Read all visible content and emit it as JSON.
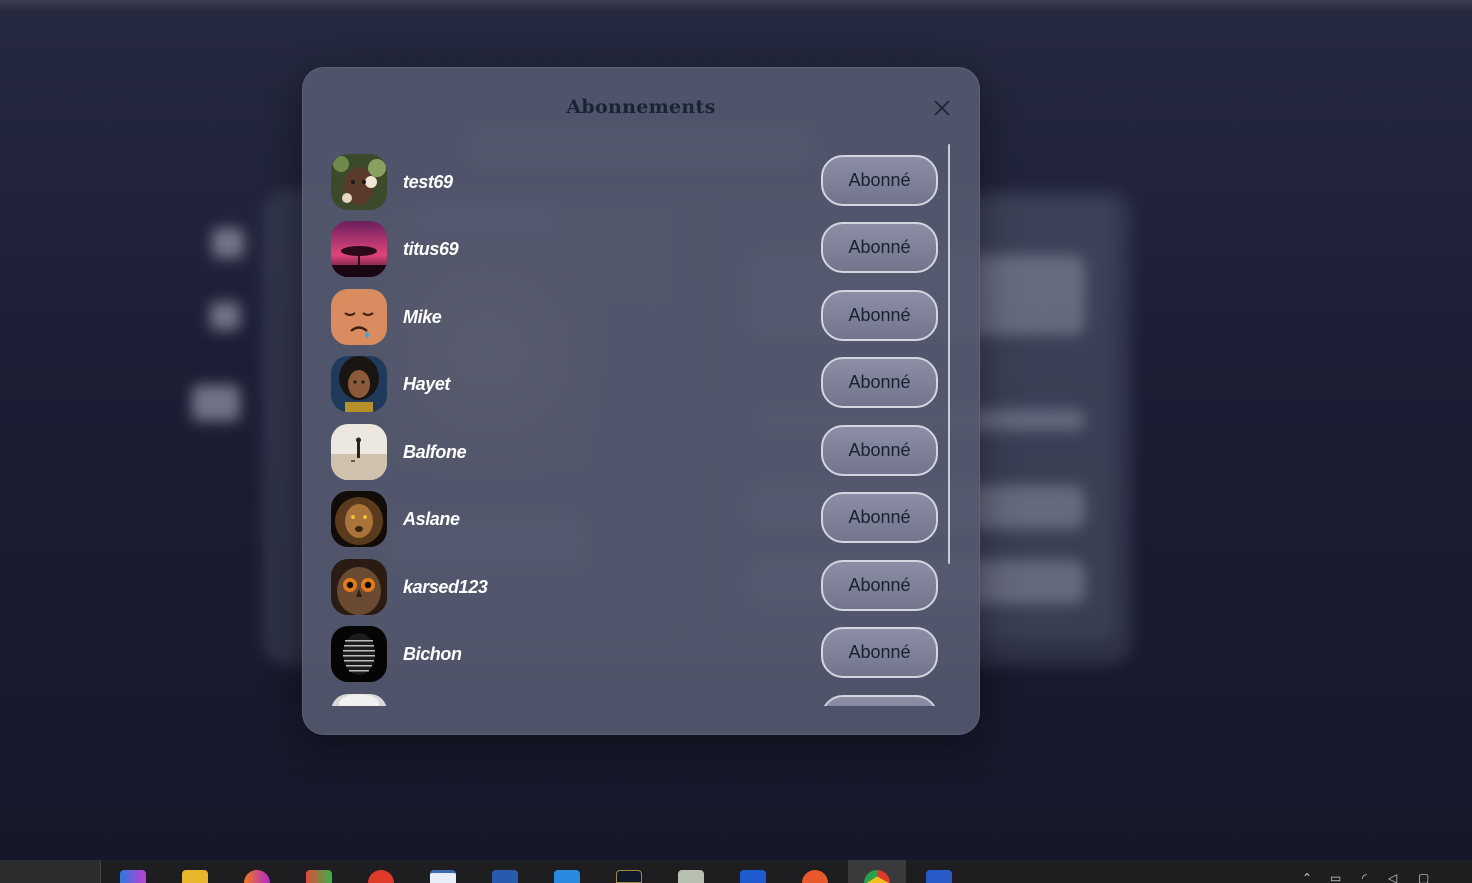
{
  "modal": {
    "title": "Abonnements",
    "close_icon": "close-icon",
    "followings": [
      {
        "username": "test69",
        "button_label": "Abonné",
        "avatar": "woman-with-flowers-avatar"
      },
      {
        "username": "titus69",
        "button_label": "Abonné",
        "avatar": "pink-tree-sunset-avatar"
      },
      {
        "username": "Mike",
        "button_label": "Abonné",
        "avatar": "sad-face-emoji-avatar"
      },
      {
        "username": "Hayet",
        "button_label": "Abonné",
        "avatar": "woman-portrait-avatar"
      },
      {
        "username": "Balfone",
        "button_label": "Abonné",
        "avatar": "beach-figure-avatar"
      },
      {
        "username": "Aslane",
        "button_label": "Abonné",
        "avatar": "lion-avatar"
      },
      {
        "username": "karsed123",
        "button_label": "Abonné",
        "avatar": "owl-avatar"
      },
      {
        "username": "Bichon",
        "button_label": "Abonné",
        "avatar": "striped-mask-avatar"
      },
      {
        "username": "",
        "button_label": "",
        "avatar": "partially-visible-avatar"
      }
    ]
  },
  "colors": {
    "modal_bg": "#54586e",
    "title": "#182434",
    "button_border": "#d3d5df",
    "username": "#ffffff"
  },
  "taskbar": {
    "icons": [
      "copilot-icon",
      "file-explorer-icon",
      "firefox-icon",
      "paint-icon",
      "app-red-icon",
      "window-app-icon",
      "shield-app-icon",
      "vscode-icon",
      "dark-app-icon",
      "image-app-icon",
      "mail-app-icon",
      "orange-app-icon",
      "chrome-icon",
      "word-icon"
    ]
  }
}
